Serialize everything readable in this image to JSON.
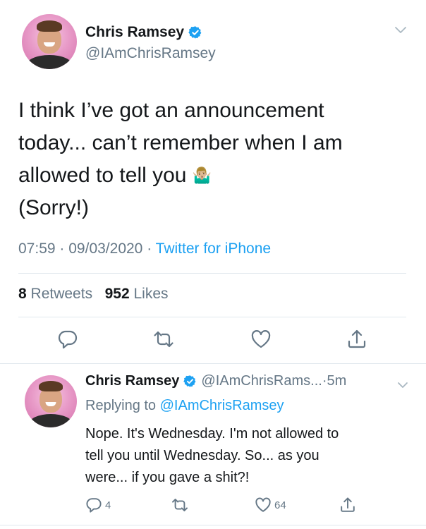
{
  "main_tweet": {
    "author": {
      "display_name": "Chris Ramsey",
      "handle": "@IAmChrisRamsey",
      "verified": true
    },
    "text_lines": [
      "I think I’ve got an announcement",
      "today... can’t remember when I am",
      "allowed to tell you",
      "(Sorry!)"
    ],
    "emoji": "🤷🏼‍♂️",
    "time": "07:59",
    "date": "09/03/2020",
    "separator": "·",
    "source": "Twitter for iPhone",
    "retweets_count": "8",
    "retweets_label": "Retweets",
    "likes_count": "952",
    "likes_label": "Likes",
    "actions": [
      "reply-icon",
      "retweet-icon",
      "like-icon",
      "share-icon"
    ]
  },
  "reply_tweet": {
    "author": {
      "display_name": "Chris Ramsey",
      "handle": "@IAmChrisRams...",
      "verified": true
    },
    "separator": "·",
    "time_ago": "5m",
    "replying_prefix": "Replying to",
    "replying_to": "@IAmChrisRamsey",
    "text_lines": [
      "Nope. It's Wednesday. I'm not allowed to",
      "tell you until Wednesday. So... as you",
      "were... if you gave a shit?!"
    ],
    "reply_count": "4",
    "like_count": "64"
  },
  "colors": {
    "accent": "#1da1f2",
    "secondary_text": "#657786",
    "primary_text": "#14171a",
    "divider": "#e1e8ed"
  }
}
